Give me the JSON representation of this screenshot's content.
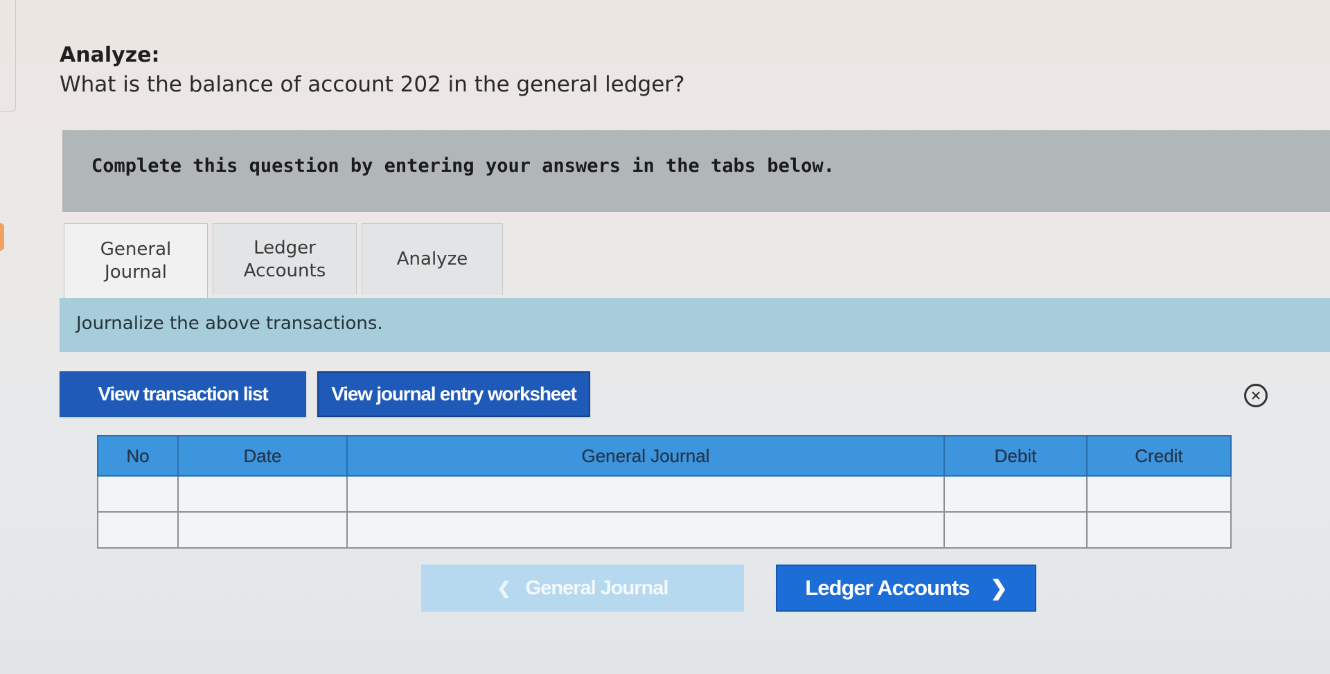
{
  "header": {
    "label": "Analyze:",
    "question": "What is the balance of account 202 in the general ledger?"
  },
  "instructions": {
    "text": "Complete this question by entering your answers in the tabs below."
  },
  "tabs": [
    {
      "line1": "General",
      "line2": "Journal",
      "active": true
    },
    {
      "line1": "Ledger",
      "line2": "Accounts",
      "active": false
    },
    {
      "line1": "Analyze",
      "line2": "",
      "active": false
    }
  ],
  "tab_instruction": "Journalize the above transactions.",
  "buttons": {
    "view_transactions": "View transaction list",
    "view_worksheet": "View journal entry worksheet"
  },
  "table": {
    "headers": [
      "No",
      "Date",
      "General Journal",
      "Debit",
      "Credit"
    ],
    "rows": [
      [
        "",
        "",
        "",
        "",
        ""
      ],
      [
        "",
        "",
        "",
        "",
        ""
      ]
    ]
  },
  "nav": {
    "prev_label": "General Journal",
    "next_label": "Ledger Accounts"
  },
  "colors": {
    "primary_button": "#1f5ab8",
    "table_header": "#3d95de",
    "sub_banner": "#a7cddb",
    "instruction_banner": "#b1b7b8",
    "next_button": "#1c6ed6",
    "prev_button_disabled": "#b7d9ef"
  },
  "icons": {
    "close": "close-circle-icon",
    "prev": "chevron-left-icon",
    "next": "chevron-right-icon"
  }
}
